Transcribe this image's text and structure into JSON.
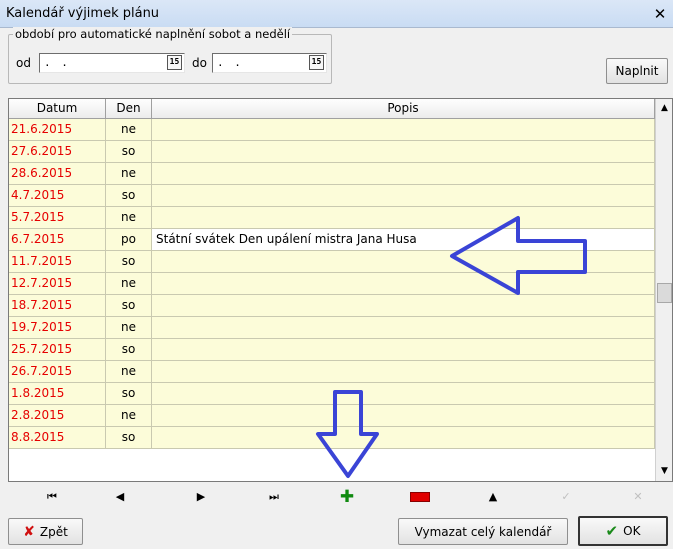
{
  "window": {
    "title": "Kalendář výjimek plánu",
    "close_glyph": "✕"
  },
  "autofill": {
    "legend": "období pro automatické naplnění sobot a nedělí",
    "from_label": "od",
    "from_value": ". .",
    "to_label": "do",
    "to_value": ". .",
    "calendar_icon_glyph": "15",
    "fill_button": "Naplnit"
  },
  "grid": {
    "columns": [
      "Datum",
      "Den",
      "Popis"
    ],
    "rows": [
      {
        "date": "21.6.2015",
        "day": "ne",
        "desc": ""
      },
      {
        "date": "27.6.2015",
        "day": "so",
        "desc": ""
      },
      {
        "date": "28.6.2015",
        "day": "ne",
        "desc": ""
      },
      {
        "date": "4.7.2015",
        "day": "so",
        "desc": ""
      },
      {
        "date": "5.7.2015",
        "day": "ne",
        "desc": ""
      },
      {
        "date": "6.7.2015",
        "day": "po",
        "desc": "Státní svátek Den upálení mistra Jana Husa"
      },
      {
        "date": "11.7.2015",
        "day": "so",
        "desc": ""
      },
      {
        "date": "12.7.2015",
        "day": "ne",
        "desc": ""
      },
      {
        "date": "18.7.2015",
        "day": "so",
        "desc": ""
      },
      {
        "date": "19.7.2015",
        "day": "ne",
        "desc": ""
      },
      {
        "date": "25.7.2015",
        "day": "so",
        "desc": ""
      },
      {
        "date": "26.7.2015",
        "day": "ne",
        "desc": ""
      },
      {
        "date": "1.8.2015",
        "day": "so",
        "desc": ""
      },
      {
        "date": "2.8.2015",
        "day": "ne",
        "desc": ""
      },
      {
        "date": "8.8.2015",
        "day": "so",
        "desc": ""
      }
    ],
    "scroll_up_glyph": "▲",
    "scroll_down_glyph": "▼"
  },
  "navigator": {
    "first": "⏮",
    "prior": "◀",
    "next": "▶",
    "last": "⏭",
    "insert": "✚",
    "edit": "▲",
    "post": "✓",
    "cancel": "✕"
  },
  "footer": {
    "back_button": "Zpět",
    "back_icon": "✘",
    "clear_button": "Vymazat celý kalendář",
    "ok_button": "OK",
    "ok_icon": "✔"
  },
  "colors": {
    "date_red": "#e60000",
    "row_bg": "#fcfcd9",
    "annotation_arrow": "#3a44d6",
    "insert_green": "#108a10",
    "delete_red": "#e00000"
  }
}
